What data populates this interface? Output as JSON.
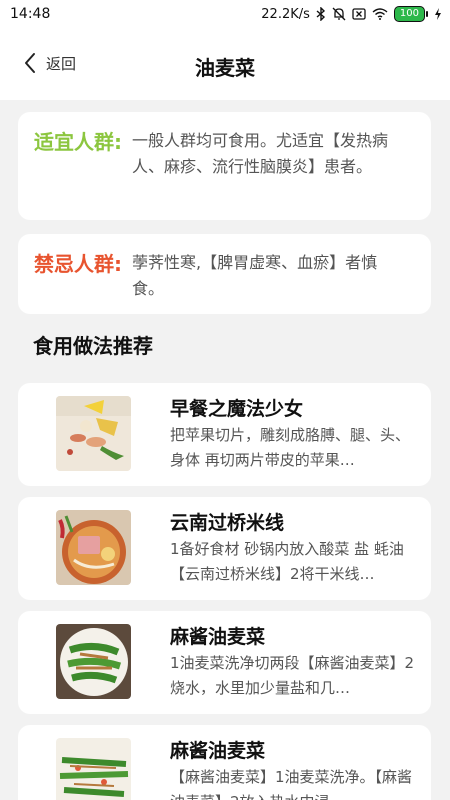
{
  "status_bar": {
    "time": "14:48",
    "net_speed": "22.2K/s",
    "battery": "100"
  },
  "nav": {
    "back_label": "返回",
    "title": "油麦菜"
  },
  "suitable": {
    "label": "适宜人群:",
    "text": "一般人群均可食用。尤适宜【发热病人、麻疹、流行性脑膜炎】患者。"
  },
  "forbidden": {
    "label": "禁忌人群:",
    "text": "荸荠性寒,【脾胃虚寒、血瘀】者慎食。"
  },
  "section_title": "食用做法推荐",
  "recipes": [
    {
      "title": "早餐之魔法少女",
      "desc": "把苹果切片，雕刻成胳膊、腿、头、身体 再切两片带皮的苹果…"
    },
    {
      "title": "云南过桥米线",
      "desc": "1备好食材 砂锅内放入酸菜 盐 蚝油【云南过桥米线】2将干米线…"
    },
    {
      "title": "麻酱油麦菜",
      "desc": "1油麦菜洗净切两段【麻酱油麦菜】2烧水，水里加少量盐和几…"
    },
    {
      "title": "麻酱油麦菜",
      "desc": "【麻酱油麦菜】1油麦菜洗净。【麻酱油麦菜】2放入热水中浸…"
    }
  ],
  "colors": {
    "suitable_label": "#8cc63f",
    "forbidden_label": "#e8542f",
    "battery": "#2db84b"
  }
}
